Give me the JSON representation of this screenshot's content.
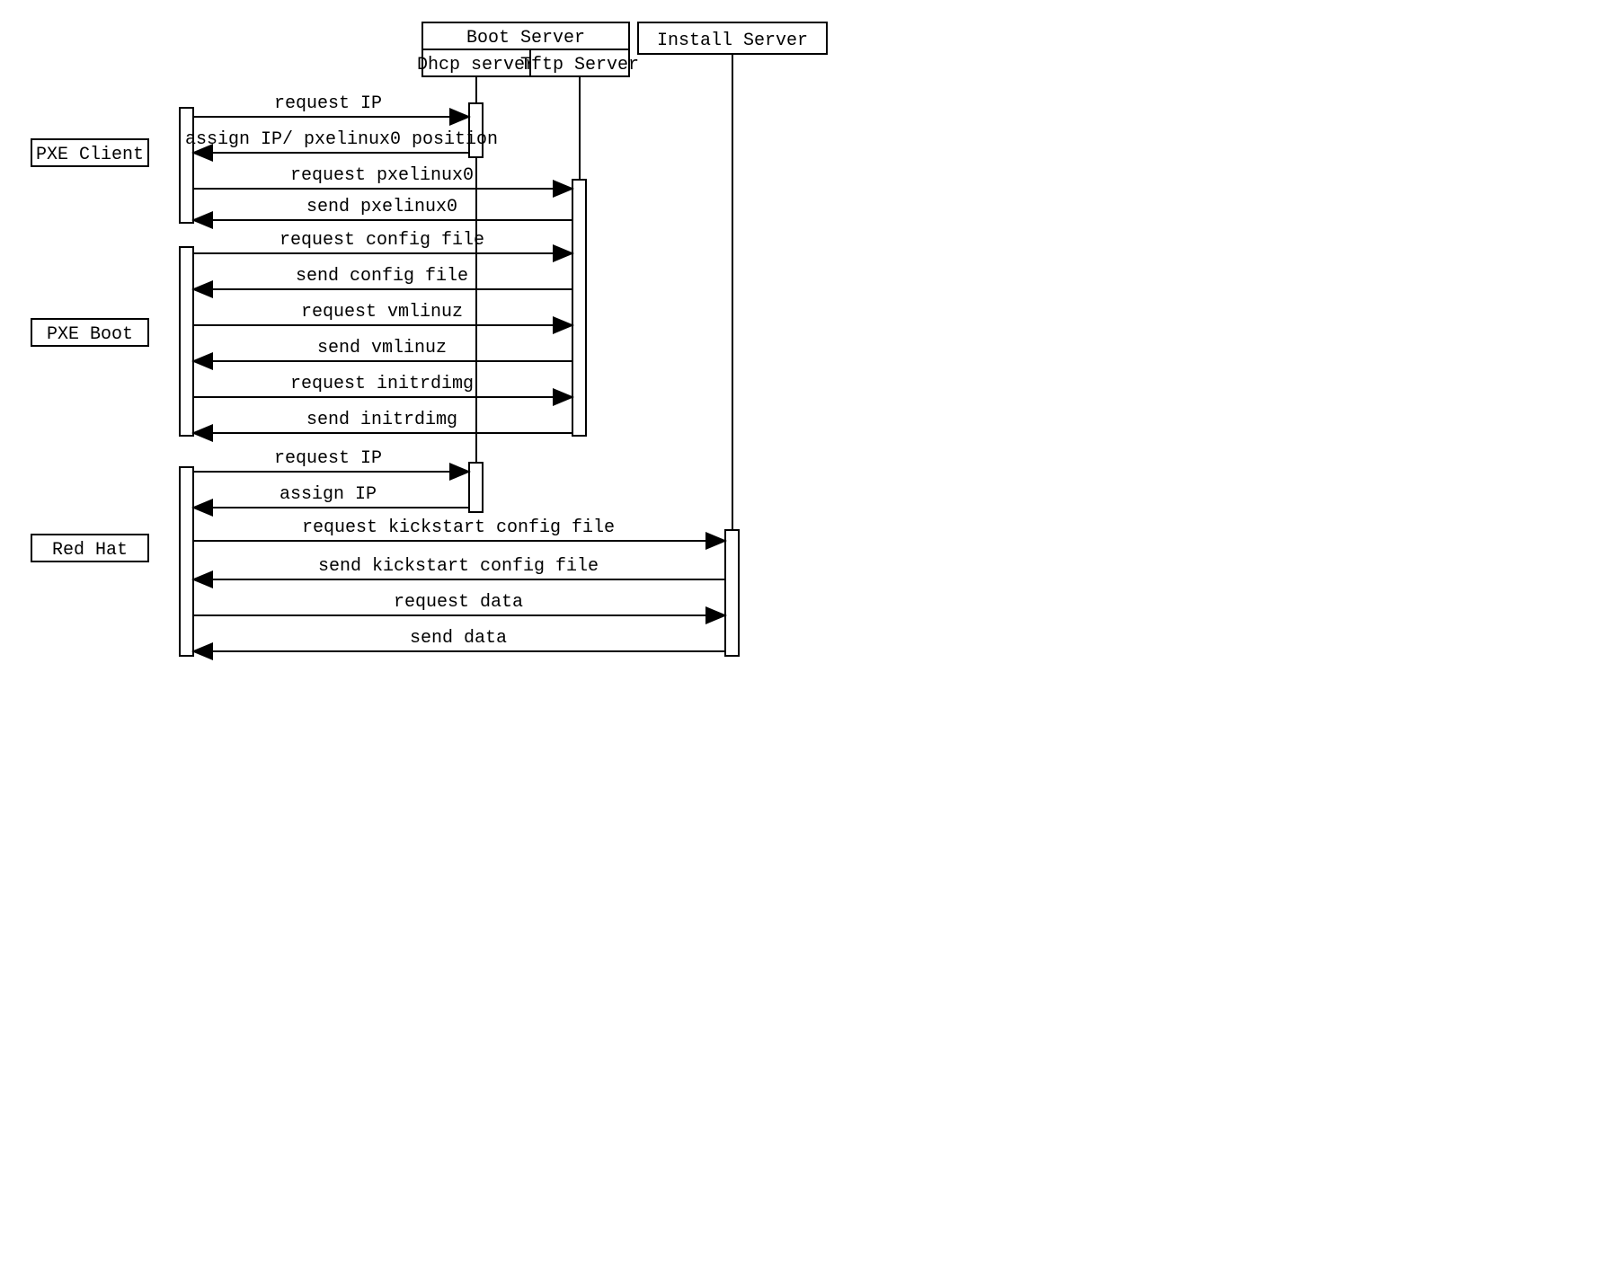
{
  "participants": {
    "boot_server": "Boot Server",
    "dhcp_server": "Dhcp server",
    "tftp_server": "Tftp Server",
    "install_server": "Install Server"
  },
  "phases": {
    "pxe_client": "PXE Client",
    "pxe_boot": "PXE Boot",
    "red_hat": "Red Hat"
  },
  "messages": {
    "m1": "request IP",
    "m2": "assign IP/ pxelinux0 position",
    "m3": "request pxelinux0",
    "m4": "send pxelinux0",
    "m5": "request config file",
    "m6": "send config file",
    "m7": "request vmlinuz",
    "m8": "send vmlinuz",
    "m9": "request initrdimg",
    "m10": "send  initrdimg",
    "m11": "request IP",
    "m12": "assign IP",
    "m13": "request kickstart config file",
    "m14": "send kickstart config file",
    "m15": "request data",
    "m16": "send data"
  }
}
